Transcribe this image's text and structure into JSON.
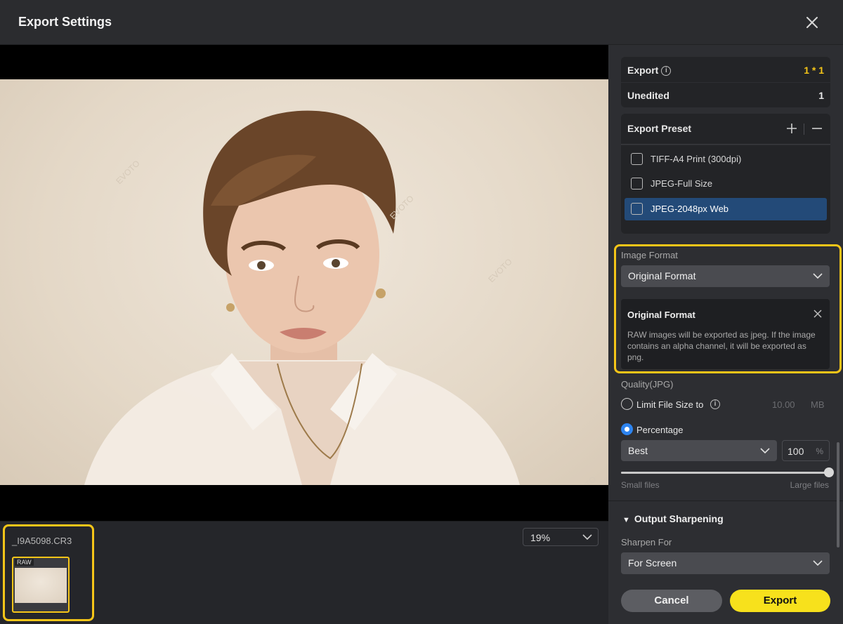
{
  "window": {
    "title": "Export Settings"
  },
  "preview": {
    "watermark": "EVOTO",
    "zoom": "19%"
  },
  "filmstrip": {
    "file_name": "_I9A5098.CR3",
    "thumb_badge": "RAW"
  },
  "summary": {
    "export_label": "Export",
    "export_value": "1 * 1",
    "unedited_label": "Unedited",
    "unedited_value": "1"
  },
  "presets": {
    "header": "Export Preset",
    "items": [
      {
        "label": "TIFF-A4 Print (300dpi)",
        "selected": false
      },
      {
        "label": "JPEG-Full Size",
        "selected": false
      },
      {
        "label": "JPEG-2048px Web",
        "selected": true
      }
    ]
  },
  "image_format": {
    "label": "Image Format",
    "value": "Original Format",
    "tooltip_title": "Original Format",
    "tooltip_body": "RAW images will be exported as jpeg. If the image contains an alpha channel, it will be exported as png."
  },
  "quality": {
    "label": "Quality(JPG)",
    "limit_label": "Limit File Size to",
    "limit_value": "10.00",
    "limit_unit": "MB",
    "percentage_label": "Percentage",
    "preset_value": "Best",
    "percent_value": "100",
    "percent_unit": "%",
    "slider_level": 1.0,
    "min_label": "Small files",
    "max_label": "Large files"
  },
  "sharpening": {
    "title": "Output Sharpening",
    "sharpen_for_label": "Sharpen For",
    "sharpen_for_value": "For Screen"
  },
  "actions": {
    "cancel": "Cancel",
    "export": "Export"
  },
  "colors": {
    "accent_yellow": "#f5c518",
    "export_yellow": "#f7e11c",
    "selection_blue": "#234a78",
    "radio_blue": "#2d84f0"
  }
}
